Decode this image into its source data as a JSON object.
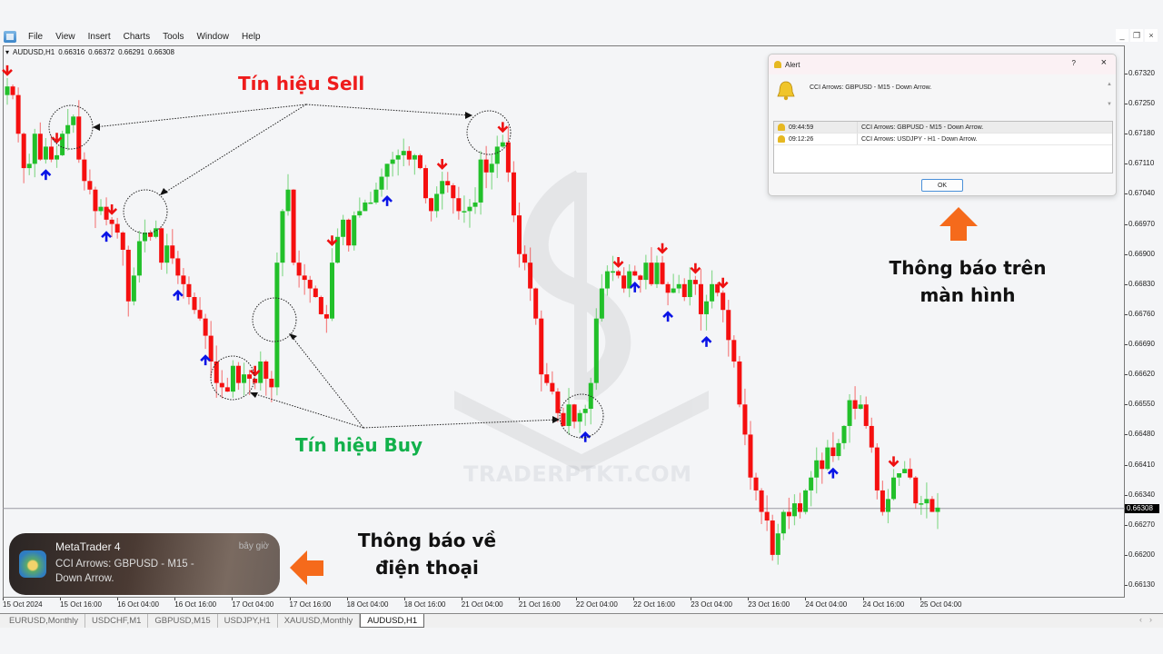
{
  "menu": {
    "items": [
      "File",
      "View",
      "Insert",
      "Charts",
      "Tools",
      "Window",
      "Help"
    ],
    "window_controls": [
      "_",
      "❐",
      "×"
    ]
  },
  "chart_header": {
    "symbol": "AUDUSD,H1",
    "open": "0.66316",
    "high": "0.66372",
    "low": "0.66291",
    "close": "0.66308"
  },
  "price_axis": {
    "labels": [
      "0.67320",
      "0.67250",
      "0.67180",
      "0.67110",
      "0.67040",
      "0.66970",
      "0.66900",
      "0.66830",
      "0.66760",
      "0.66690",
      "0.66620",
      "0.66550",
      "0.66480",
      "0.66410",
      "0.66340",
      "0.66270",
      "0.66200",
      "0.66130"
    ],
    "current_price": "0.66308"
  },
  "time_axis": {
    "labels": [
      "15 Oct 2024",
      "15 Oct 16:00",
      "16 Oct 04:00",
      "16 Oct 16:00",
      "17 Oct 04:00",
      "17 Oct 16:00",
      "18 Oct 04:00",
      "18 Oct 16:00",
      "21 Oct 04:00",
      "21 Oct 16:00",
      "22 Oct 04:00",
      "22 Oct 16:00",
      "23 Oct 04:00",
      "23 Oct 16:00",
      "24 Oct 04:00",
      "24 Oct 16:00",
      "25 Oct 04:00"
    ]
  },
  "tabs": [
    {
      "label": "EURUSD,Monthly",
      "active": false
    },
    {
      "label": "USDCHF,M1",
      "active": false
    },
    {
      "label": "GBPUSD,M15",
      "active": false
    },
    {
      "label": "USDJPY,H1",
      "active": false
    },
    {
      "label": "XAUUSD,Monthly",
      "active": false
    },
    {
      "label": "AUDUSD,H1",
      "active": true
    }
  ],
  "alert_dialog": {
    "title": "Alert",
    "help": "?",
    "close": "×",
    "message": "CCI Arrows: GBPUSD - M15 - Down Arrow.",
    "rows": [
      {
        "time": "09:44:59",
        "text": "CCI Arrows: GBPUSD - M15 - Down Arrow."
      },
      {
        "time": "09:12:26",
        "text": "CCI Arrows: USDJPY - H1 - Down Arrow."
      }
    ],
    "ok_label": "OK"
  },
  "phone_notification": {
    "app": "MetaTrader 4",
    "time": "bây giờ",
    "body": "CCI Arrows: GBPUSD - M15 - Down Arrow."
  },
  "annotations": {
    "sell": "Tín hiệu Sell",
    "buy": "Tín hiệu Buy",
    "screen": "Thông báo trên màn hình",
    "phone": "Thông báo về điện thoại",
    "watermark": "TRADERPTKT.COM"
  },
  "colors": {
    "bull": "#22c02a",
    "bear": "#f50f0f",
    "sell_arrow": "#ee1111",
    "buy_arrow": "#0a14e6",
    "orange_arrow": "#f56a1b"
  },
  "chart_data": {
    "type": "candlestick",
    "symbol": "AUDUSD",
    "timeframe": "H1",
    "ylim": [
      0.661,
      0.6735
    ],
    "closes": [
      0.6729,
      0.6727,
      0.6718,
      0.671,
      0.6711,
      0.6718,
      0.6712,
      0.6715,
      0.6712,
      0.6713,
      0.6718,
      0.672,
      0.6722,
      0.6712,
      0.6707,
      0.6705,
      0.67,
      0.6701,
      0.6698,
      0.6697,
      0.6695,
      0.6691,
      0.6679,
      0.6685,
      0.6693,
      0.6695,
      0.6694,
      0.6696,
      0.6688,
      0.6692,
      0.6689,
      0.6685,
      0.6683,
      0.668,
      0.6677,
      0.6675,
      0.6671,
      0.6665,
      0.666,
      0.6659,
      0.6658,
      0.6664,
      0.666,
      0.6662,
      0.6661,
      0.666,
      0.6665,
      0.6661,
      0.6659,
      0.6688,
      0.67,
      0.6705,
      0.6688,
      0.6685,
      0.6684,
      0.6682,
      0.668,
      0.6676,
      0.6675,
      0.6688,
      0.6694,
      0.6698,
      0.6692,
      0.6699,
      0.67,
      0.6702,
      0.6702,
      0.6705,
      0.6708,
      0.6711,
      0.6712,
      0.6713,
      0.6714,
      0.6712,
      0.6713,
      0.671,
      0.6703,
      0.67,
      0.6704,
      0.6707,
      0.6706,
      0.6703,
      0.67,
      0.67,
      0.6701,
      0.6702,
      0.6712,
      0.6709,
      0.6711,
      0.6715,
      0.6716,
      0.6709,
      0.6699,
      0.669,
      0.6688,
      0.6682,
      0.6675,
      0.6662,
      0.666,
      0.6658,
      0.6653,
      0.665,
      0.6655,
      0.6651,
      0.6653,
      0.6654,
      0.666,
      0.6675,
      0.6682,
      0.6686,
      0.6686,
      0.6685,
      0.6682,
      0.6686,
      0.6685,
      0.6684,
      0.6688,
      0.6683,
      0.6688,
      0.6683,
      0.6681,
      0.6682,
      0.6683,
      0.668,
      0.6684,
      0.6683,
      0.6676,
      0.6679,
      0.6683,
      0.6681,
      0.6677,
      0.667,
      0.6665,
      0.6655,
      0.6648,
      0.6638,
      0.6635,
      0.663,
      0.6628,
      0.662,
      0.6625,
      0.663,
      0.6629,
      0.6632,
      0.663,
      0.6635,
      0.6638,
      0.6642,
      0.664,
      0.6645,
      0.6643,
      0.6646,
      0.665,
      0.6656,
      0.6654,
      0.6655,
      0.665,
      0.6645,
      0.6635,
      0.663,
      0.6633,
      0.6638,
      0.6639,
      0.664,
      0.6638,
      0.6632,
      0.6632,
      0.6633,
      0.663,
      0.6631
    ],
    "sell_arrow_indices": [
      0,
      9,
      19,
      45,
      59,
      79,
      90,
      111,
      119,
      125,
      130,
      161
    ],
    "buy_arrow_indices": [
      7,
      18,
      31,
      36,
      69,
      105,
      114,
      120,
      127,
      150
    ],
    "current_price": 0.66308,
    "annotated_circles": {
      "sell": [
        9,
        19,
        89
      ],
      "buy": [
        31,
        36,
        104
      ]
    }
  }
}
